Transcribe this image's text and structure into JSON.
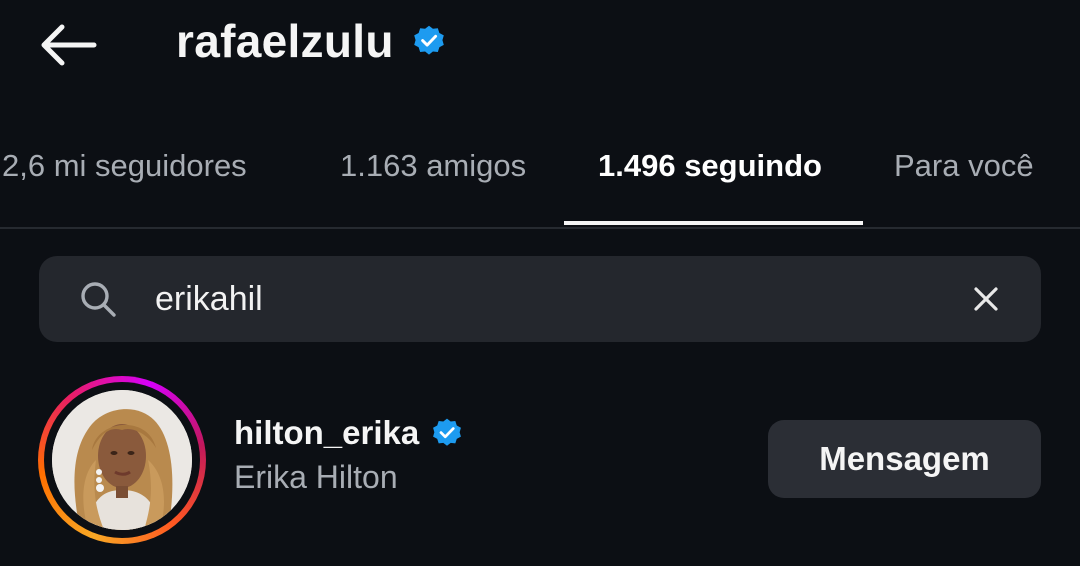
{
  "header": {
    "title": "rafaelzulu",
    "back_icon": "arrow-left-icon",
    "verified_icon": "verified-badge-icon"
  },
  "tabs": [
    {
      "label": "2,6 mi seguidores",
      "active": false
    },
    {
      "label": "1.163 amigos",
      "active": false
    },
    {
      "label": "1.496 seguindo",
      "active": true
    },
    {
      "label": "Para você",
      "active": false
    }
  ],
  "search": {
    "value": "erikahil",
    "search_icon": "search-icon",
    "clear_icon": "close-icon"
  },
  "results": [
    {
      "username": "hilton_erika",
      "full_name": "Erika Hilton",
      "verified": true,
      "button_label": "Mensagem"
    }
  ],
  "colors": {
    "background": "#0c0f14",
    "verified_blue": "#1d9bf0",
    "secondary_text": "#a8adb4",
    "surface": "#24272d"
  }
}
